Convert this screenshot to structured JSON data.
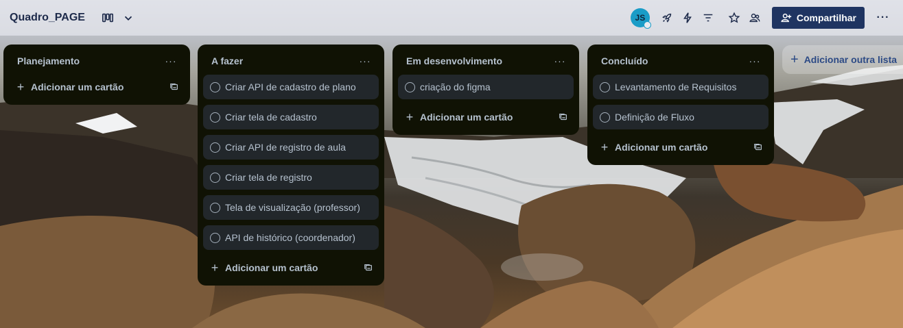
{
  "header": {
    "board_title": "Quadro_PAGE",
    "avatar_initials": "JS",
    "share_label": "Compartilhar",
    "more": "···"
  },
  "lists": [
    {
      "title": "Planejamento",
      "menu": "···",
      "cards": [],
      "add_label": "Adicionar um cartão"
    },
    {
      "title": "A fazer",
      "menu": "···",
      "cards": [
        "Criar API de cadastro de plano",
        "Criar tela de cadastro",
        "Criar API de registro de aula",
        "Criar tela de registro",
        "Tela de visualização (professor)",
        "API de histórico (coordenador)"
      ],
      "add_label": "Adicionar um cartão"
    },
    {
      "title": "Em desenvolvimento",
      "menu": "···",
      "cards": [
        "criação do figma"
      ],
      "add_label": "Adicionar um cartão"
    },
    {
      "title": "Concluído",
      "menu": "···",
      "cards": [
        "Levantamento de Requisitos",
        "Definição de Fluxo"
      ],
      "add_label": "Adicionar um cartão"
    }
  ],
  "add_list_label": "Adicionar outra lista",
  "colors": {
    "list_bg": "#101204",
    "card_bg": "#22272b",
    "share_button": "#1f3461",
    "avatar": "#1a9cc7"
  },
  "icons": {
    "view_switcher": "board-view-icon",
    "chevron": "chevron-down-icon",
    "power_ups": "rocket-icon",
    "automation": "lightning-icon",
    "filter": "filter-icon",
    "star": "star-icon",
    "visibility": "people-icon",
    "share": "add-person-icon",
    "card_template": "card-template-icon"
  }
}
